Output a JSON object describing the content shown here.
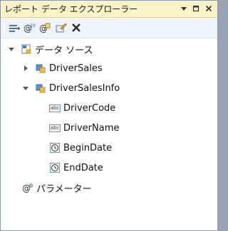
{
  "window": {
    "title": "レポート データ エクスプローラー",
    "controls": {
      "pin": "pin-icon",
      "maximize": "maximize-icon",
      "close": "close-icon"
    }
  },
  "toolbar": {
    "buttons": [
      "new-items-icon",
      "new-parameter-icon",
      "new-dataset-icon",
      "edit-icon",
      "delete-icon"
    ]
  },
  "tree": {
    "data_sources": {
      "label": "データ ソース",
      "expanded": true
    },
    "datasets": [
      {
        "label": "DriverSales",
        "expanded": false
      },
      {
        "label": "DriverSalesInfo",
        "expanded": true,
        "fields": [
          {
            "label": "DriverCode",
            "type": "abc"
          },
          {
            "label": "DriverName",
            "type": "abc"
          },
          {
            "label": "BeginDate",
            "type": "date"
          },
          {
            "label": "EndDate",
            "type": "date"
          }
        ]
      }
    ],
    "parameters": {
      "label": "パラメーター"
    }
  },
  "colors": {
    "title_bg": "#fbf3c8",
    "toolbar_bg": "#f0f4fa",
    "frame_border": "#8e99ad"
  }
}
